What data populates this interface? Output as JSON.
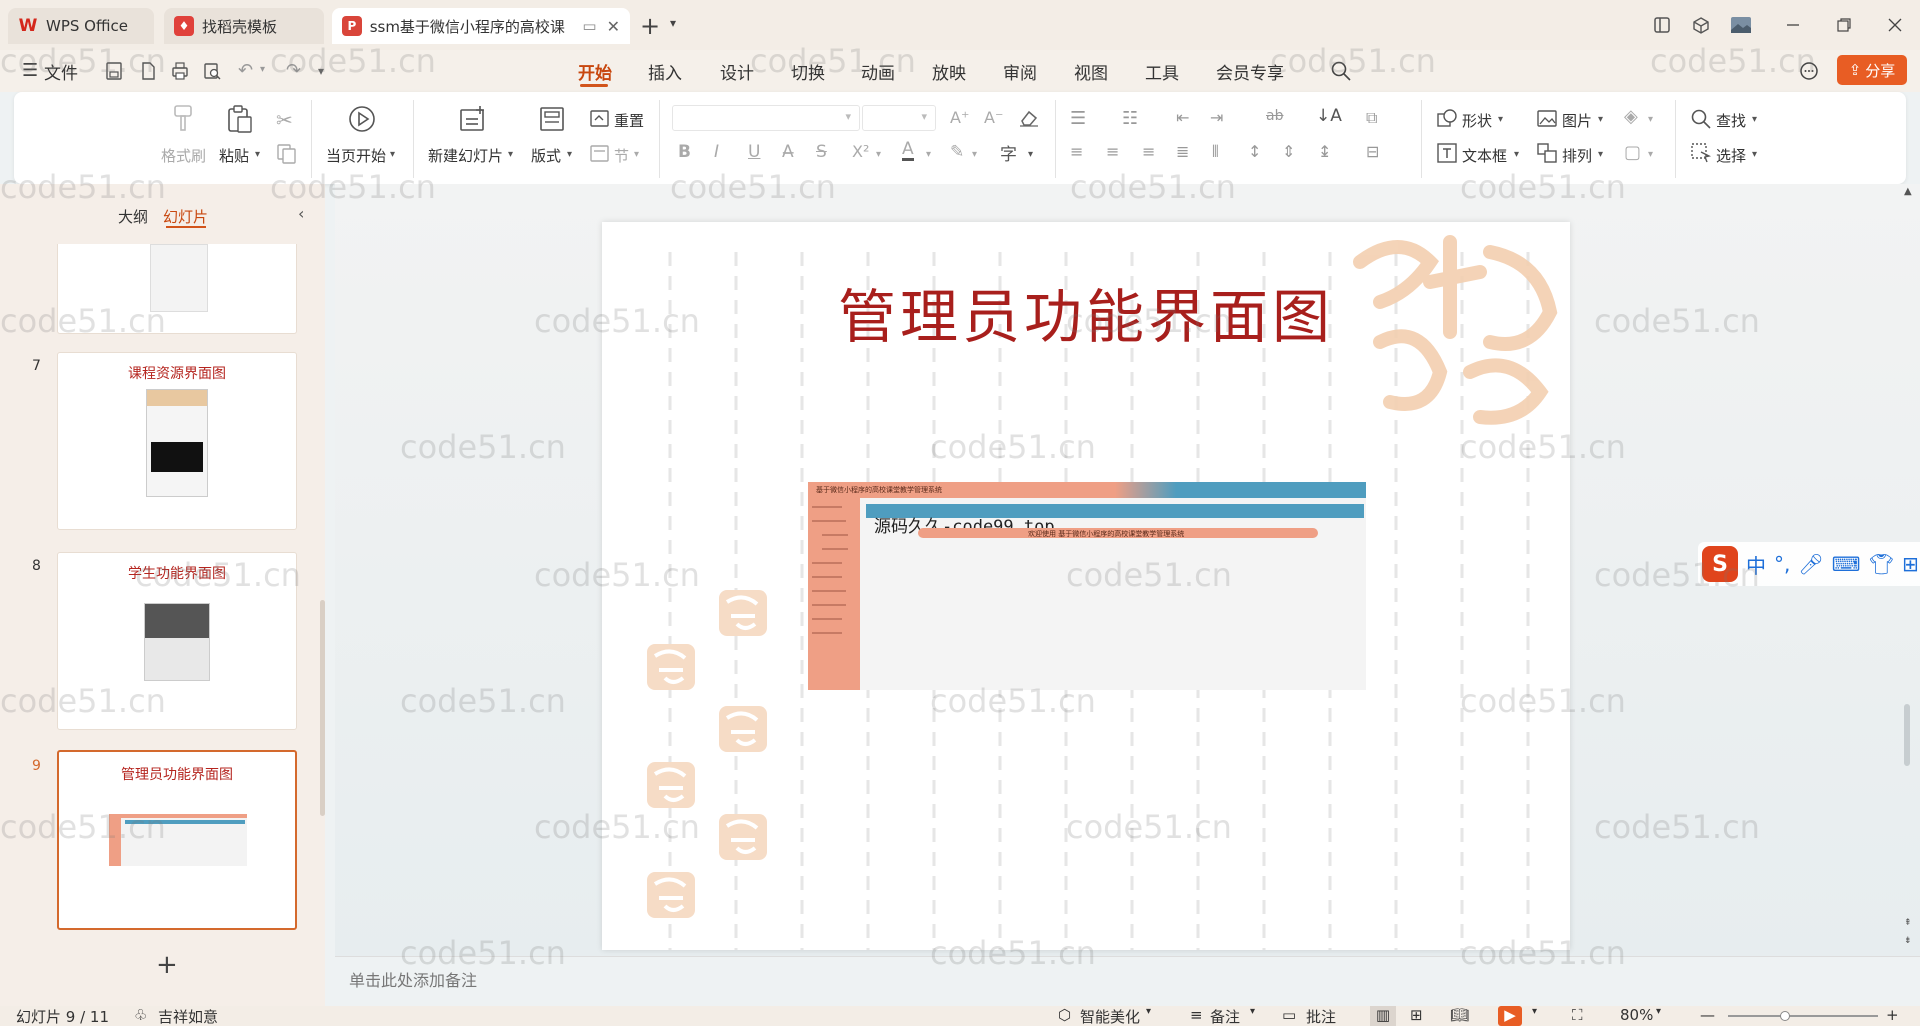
{
  "tabs": [
    {
      "label": "WPS Office",
      "icon": "wps-logo-icon"
    },
    {
      "label": "找稻壳模板",
      "icon": "docer-logo-icon"
    },
    {
      "label": "ssm基于微信小程序的高校课",
      "icon": "ppt-logo-icon"
    }
  ],
  "menu": {
    "file_label": "文件",
    "items": [
      "开始",
      "插入",
      "设计",
      "切换",
      "动画",
      "放映",
      "审阅",
      "视图",
      "工具",
      "会员专享"
    ],
    "active": "开始",
    "share_label": "分享"
  },
  "ribbon": {
    "format_painter": "格式刷",
    "paste": "粘贴",
    "play_from_current": "当页开始",
    "new_slide": "新建幻灯片",
    "layout": "版式",
    "reset": "重置",
    "section": "节",
    "shape": "形状",
    "picture": "图片",
    "find": "查找",
    "textbox": "文本框",
    "arrange": "排列",
    "select": "选择"
  },
  "left_panel": {
    "tab_outline": "大纲",
    "tab_slides": "幻灯片",
    "slides": [
      {
        "num": "7",
        "title": "课程资源界面图"
      },
      {
        "num": "8",
        "title": "学生功能界面图"
      },
      {
        "num": "9",
        "title": "管理员功能界面图",
        "selected": true
      }
    ]
  },
  "slide": {
    "title": "管理员功能界面图",
    "screenshot": {
      "header_text": "基于微信小程序的高校课堂教学管理系统",
      "overlay_text": "源码久久-code99.top",
      "welcome_text": "欢迎使用 基于微信小程序的高校课堂教学管理系统"
    }
  },
  "notes": {
    "placeholder": "单击此处添加备注"
  },
  "status": {
    "slide_counter": "幻灯片 9 / 11",
    "theme": "吉祥如意",
    "smart_beautify": "智能美化",
    "notes": "备注",
    "comment": "批注",
    "zoom": "80%"
  },
  "ime": {
    "label": "中"
  },
  "watermark_text": "code51.cn",
  "colors": {
    "accent": "#d2541b",
    "title_red": "#a81f1c",
    "salmon": "#ef9f85",
    "blue_bar": "#4f9dbf"
  }
}
